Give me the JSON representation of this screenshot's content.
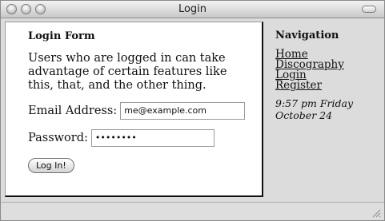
{
  "window": {
    "title": "Login"
  },
  "form": {
    "heading": "Login Form",
    "description": "Users who are logged in can take advantage of certain features like this, that, and the other thing.",
    "email_label": "Email Address:",
    "email_value": "me@example.com",
    "password_label": "Password:",
    "password_value": "••••••••",
    "submit_label": "Log In!"
  },
  "navigation": {
    "heading": "Navigation",
    "items": [
      {
        "label": "Home"
      },
      {
        "label": "Discography"
      },
      {
        "label": "Login"
      },
      {
        "label": "Register"
      }
    ],
    "timestamp_line1": "9:57 pm Friday",
    "timestamp_line2": "October 24"
  },
  "icons": {
    "close": "traffic-light-close-icon",
    "minimize": "traffic-light-minimize-icon",
    "zoom": "traffic-light-zoom-icon",
    "toolbar_toggle": "toolbar-toggle-icon",
    "resize": "resize-grip-icon"
  }
}
